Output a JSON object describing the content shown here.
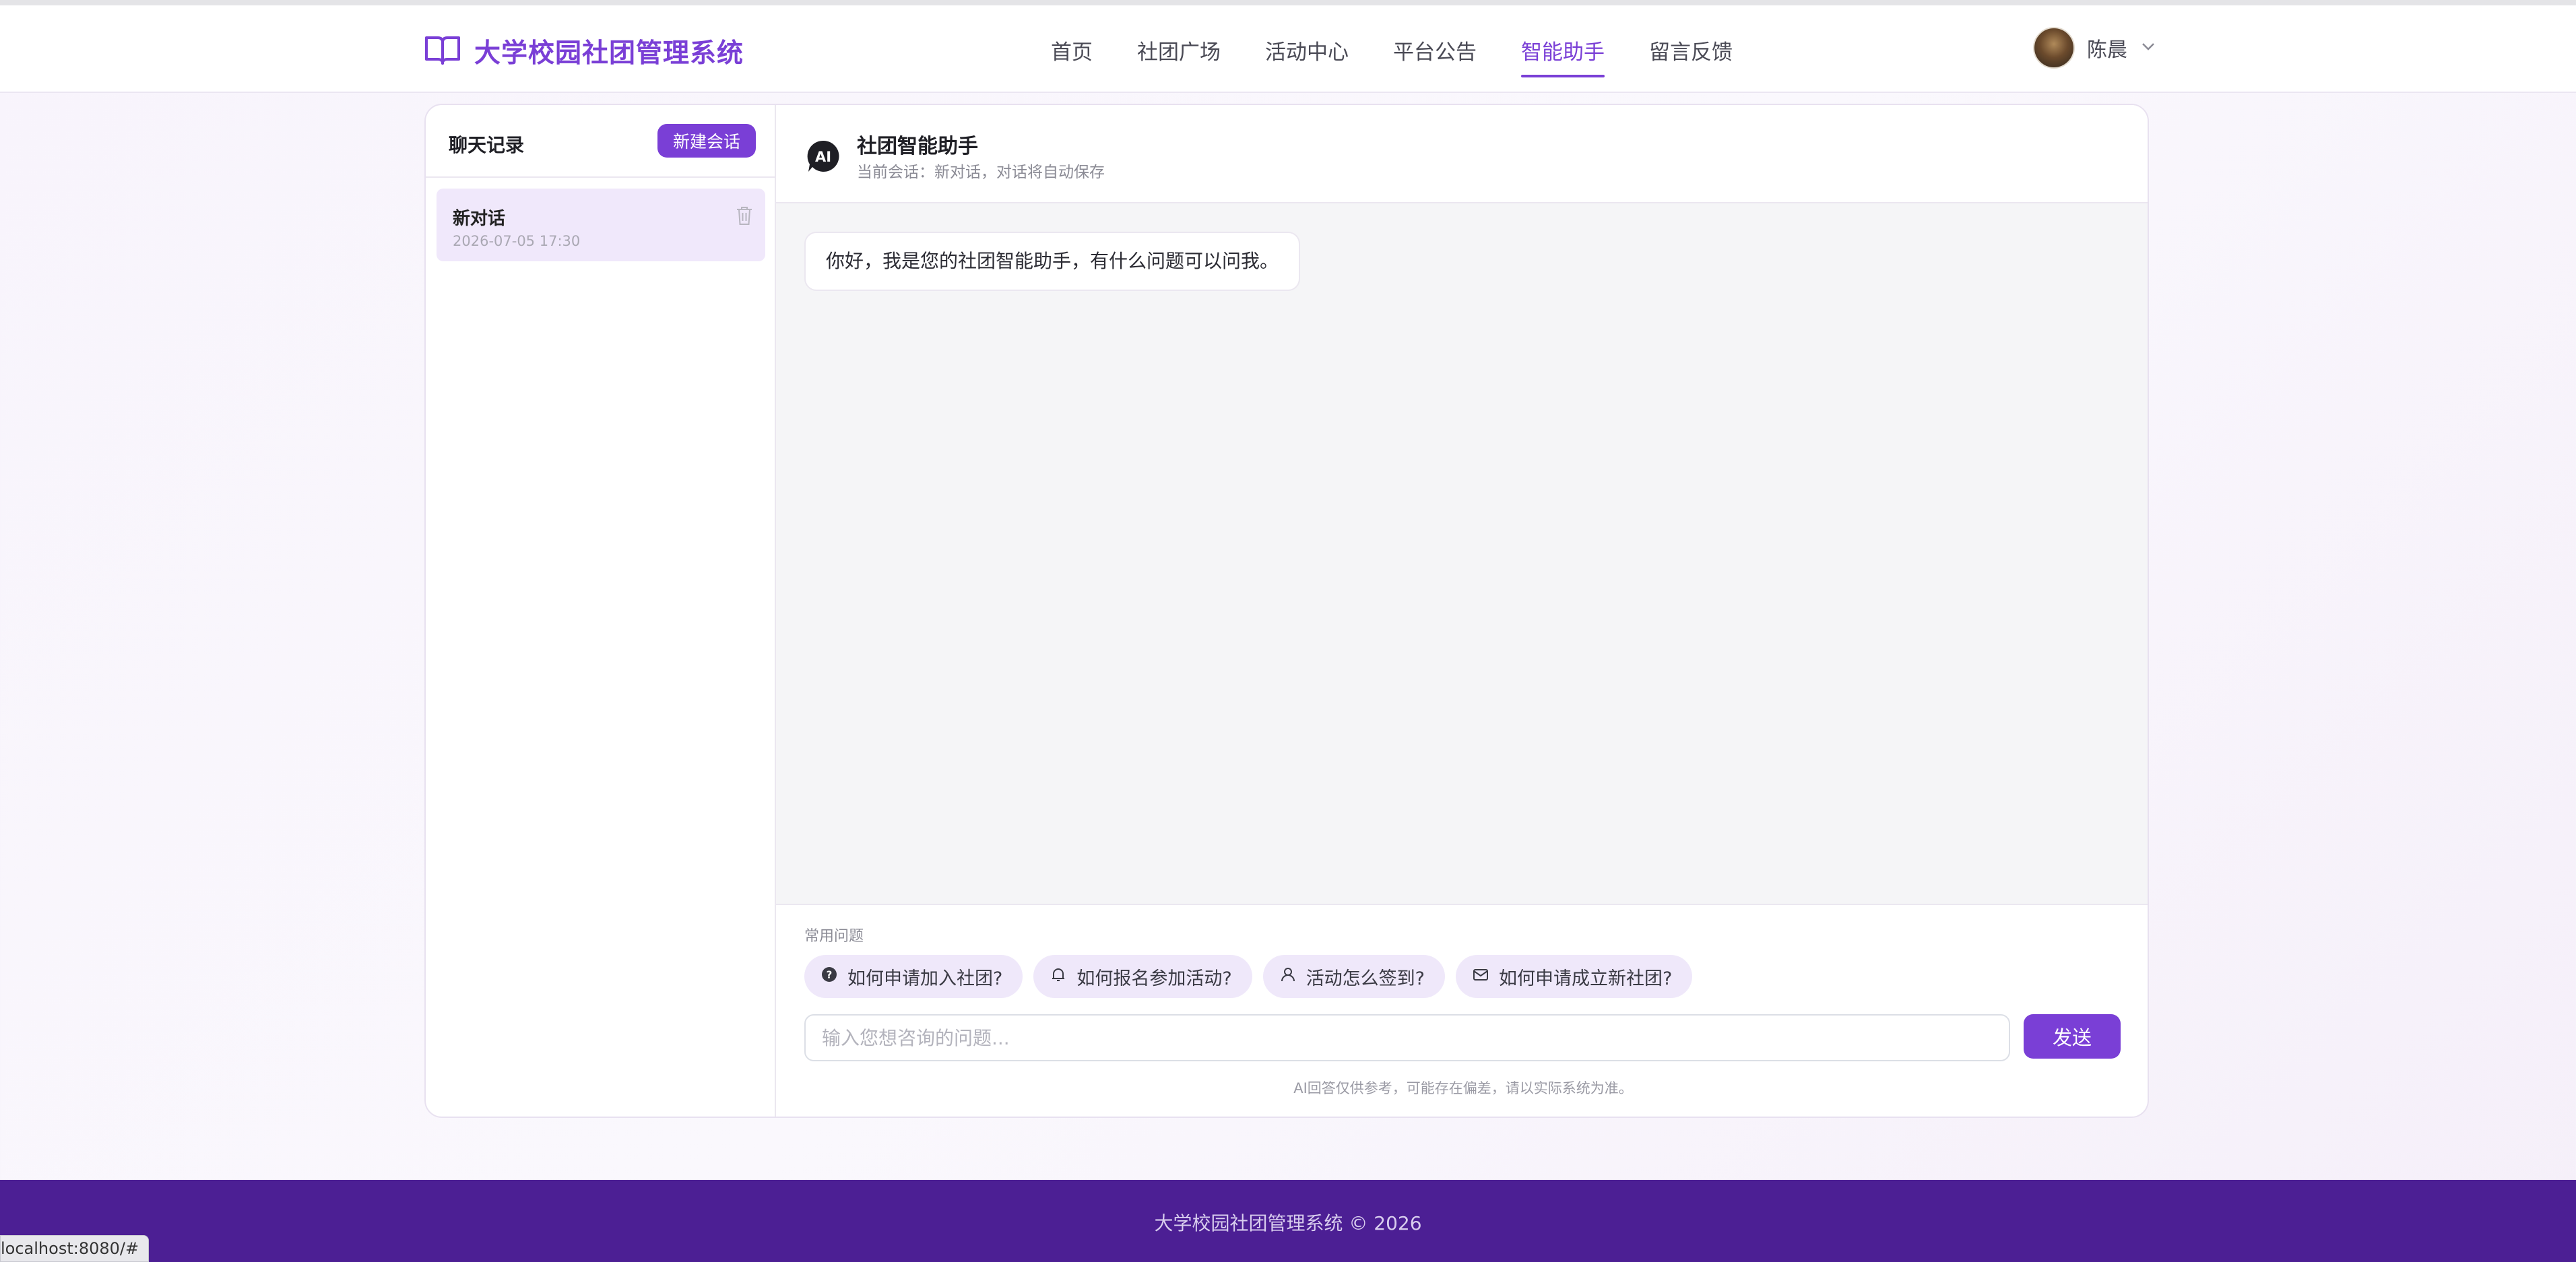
{
  "header": {
    "brand_title": "大学校园社团管理系统",
    "nav": [
      {
        "label": "首页",
        "active": false
      },
      {
        "label": "社团广场",
        "active": false
      },
      {
        "label": "活动中心",
        "active": false
      },
      {
        "label": "平台公告",
        "active": false
      },
      {
        "label": "智能助手",
        "active": true
      },
      {
        "label": "留言反馈",
        "active": false
      }
    ],
    "user_name": "陈晨"
  },
  "sidebar": {
    "title": "聊天记录",
    "new_button": "新建会话",
    "conversations": [
      {
        "title": "新对话",
        "time": "2026-07-05 17:30"
      }
    ]
  },
  "chat": {
    "title": "社团智能助手",
    "subtitle": "当前会话：新对话，对话将自动保存",
    "messages": [
      {
        "role": "assistant",
        "text": "你好，我是您的社团智能助手，有什么问题可以问我。"
      }
    ],
    "quick_label": "常用问题",
    "quick_questions": [
      {
        "icon": "question-circle-icon",
        "text": "如何申请加入社团?"
      },
      {
        "icon": "bell-icon",
        "text": "如何报名参加活动?"
      },
      {
        "icon": "user-icon",
        "text": "活动怎么签到?"
      },
      {
        "icon": "mail-icon",
        "text": "如何申请成立新社团?"
      }
    ],
    "input_placeholder": "输入您想咨询的问题...",
    "send_button": "发送",
    "disclaimer": "AI回答仅供参考，可能存在偏差，请以实际系统为准。"
  },
  "footer": {
    "text": "大学校园社团管理系统 © 2026"
  },
  "status_bar": {
    "url": "localhost:8080/#"
  },
  "colors": {
    "accent": "#7a3fd6",
    "footer_bg": "#4c1f94"
  }
}
